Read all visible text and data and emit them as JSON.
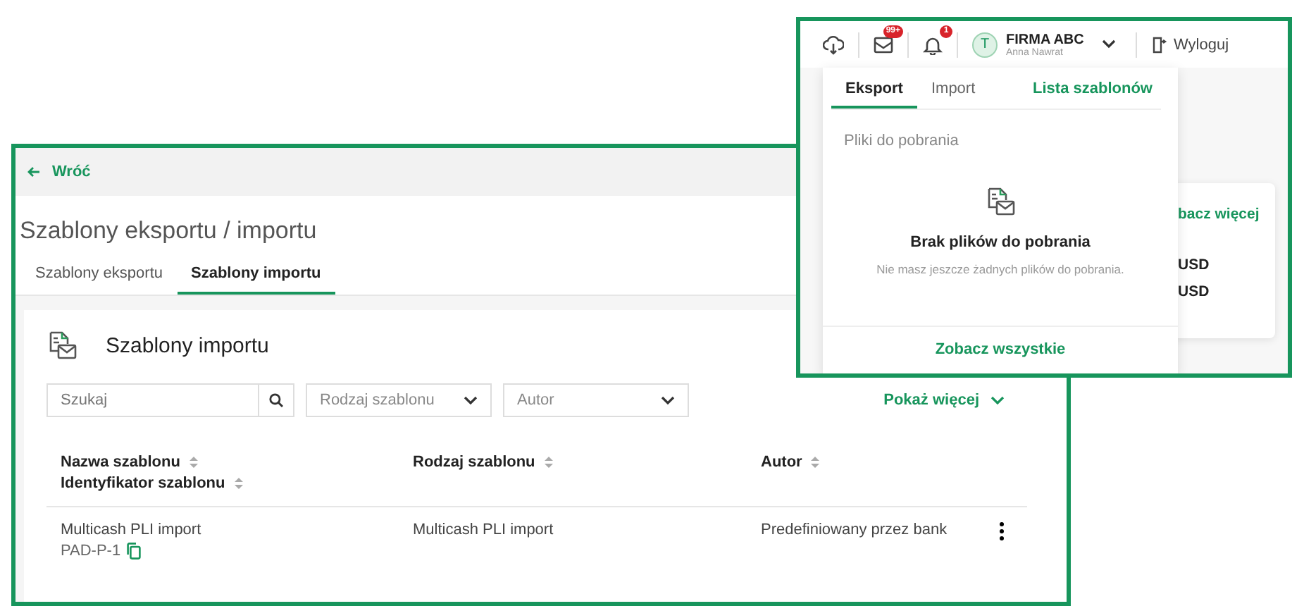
{
  "templates_window": {
    "back_link": "Wróć",
    "page_title": "Szablony eksportu / importu",
    "tabs": [
      {
        "label": "Szablony eksportu",
        "selected": false
      },
      {
        "label": "Szablony importu",
        "selected": true
      }
    ],
    "section_title": "Szablony importu",
    "search": {
      "placeholder": "Szukaj"
    },
    "dropdowns": [
      {
        "placeholder": "Rodzaj szablonu"
      },
      {
        "placeholder": "Autor"
      }
    ],
    "show_more": "Pokaż więcej",
    "table": {
      "columns": [
        {
          "label": "Nazwa szablonu",
          "sublabel": "Identyfikator szablonu"
        },
        {
          "label": "Rodzaj szablonu"
        },
        {
          "label": "Autor"
        }
      ],
      "rows": [
        {
          "name": "Multicash PLI import",
          "id": "PAD-P-1",
          "type": "Multicash PLI import",
          "author": "Predefiniowany przez bank"
        }
      ]
    }
  },
  "header_window": {
    "messages_badge": "99+",
    "notifications_badge": "1",
    "avatar": "T",
    "company": "FIRMA ABC",
    "user": "Anna Nawrat",
    "logout": "Wyloguj",
    "downloads_panel": {
      "tabs": [
        {
          "label": "Eksport",
          "selected": true
        },
        {
          "label": "Import",
          "selected": false
        }
      ],
      "templates_link": "Lista szablonów",
      "section_label": "Pliki do pobrania",
      "empty_title": "Brak plików do pobrania",
      "empty_text": "Nie masz jeszcze żadnych plików do pobrania.",
      "see_all": "Zobacz wszystkie"
    },
    "background_card": {
      "link": "bacz więcej",
      "amounts": [
        "USD",
        "USD"
      ]
    }
  }
}
